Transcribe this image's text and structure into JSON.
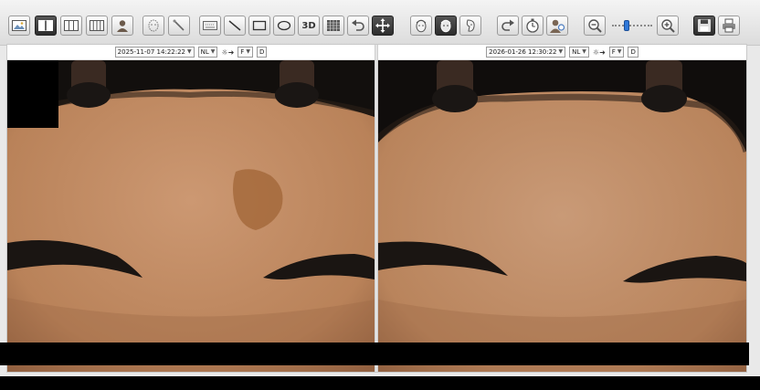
{
  "toolbar": {
    "buttons": [
      {
        "id": "image",
        "icon": "image-icon"
      },
      {
        "id": "layout-2",
        "icon": "two-pane-layout-icon",
        "active": true
      },
      {
        "id": "layout-3",
        "icon": "three-pane-layout-icon"
      },
      {
        "id": "layout-4",
        "icon": "four-pane-layout-icon"
      },
      {
        "id": "patient",
        "icon": "patient-icon"
      },
      {
        "id": "face-mask",
        "icon": "face-outline-icon"
      },
      {
        "id": "wand",
        "icon": "wand-icon"
      },
      {
        "id": "keyboard",
        "icon": "keyboard-icon"
      },
      {
        "id": "line",
        "icon": "line-tool-icon"
      },
      {
        "id": "rect",
        "icon": "rectangle-tool-icon"
      },
      {
        "id": "ellipse",
        "icon": "ellipse-tool-icon"
      },
      {
        "id": "3d",
        "icon": "3d-icon",
        "label": "3D"
      },
      {
        "id": "grid",
        "icon": "grid-icon"
      },
      {
        "id": "undo",
        "icon": "undo-icon"
      },
      {
        "id": "move",
        "icon": "move-icon",
        "active": true
      },
      {
        "id": "face-front",
        "icon": "face-front-icon"
      },
      {
        "id": "face-active",
        "icon": "face-active-icon",
        "active": true
      },
      {
        "id": "face-side",
        "icon": "face-side-icon"
      },
      {
        "id": "redo",
        "icon": "redo-icon"
      },
      {
        "id": "timer",
        "icon": "timer-icon"
      },
      {
        "id": "doctor",
        "icon": "doctor-icon"
      },
      {
        "id": "zoom-out",
        "icon": "zoom-out-icon"
      },
      {
        "id": "zoom-in",
        "icon": "zoom-in-icon"
      },
      {
        "id": "save",
        "icon": "save-icon",
        "active": true
      },
      {
        "id": "print",
        "icon": "print-icon"
      }
    ],
    "zoom_level": 0.35
  },
  "panes": [
    {
      "date": "2025-11-07 14:22:22",
      "mode": "NL",
      "light": "☼➜",
      "view": "F",
      "flag": "D"
    },
    {
      "date": "2026-01-26 12:30:22",
      "mode": "NL",
      "light": "☼➜",
      "view": "F",
      "flag": "D"
    }
  ],
  "colors": {
    "skin": "#c38c63",
    "lesion": "#a56a3c",
    "brow": "#1a1512",
    "hair": "#0f0d0c"
  }
}
